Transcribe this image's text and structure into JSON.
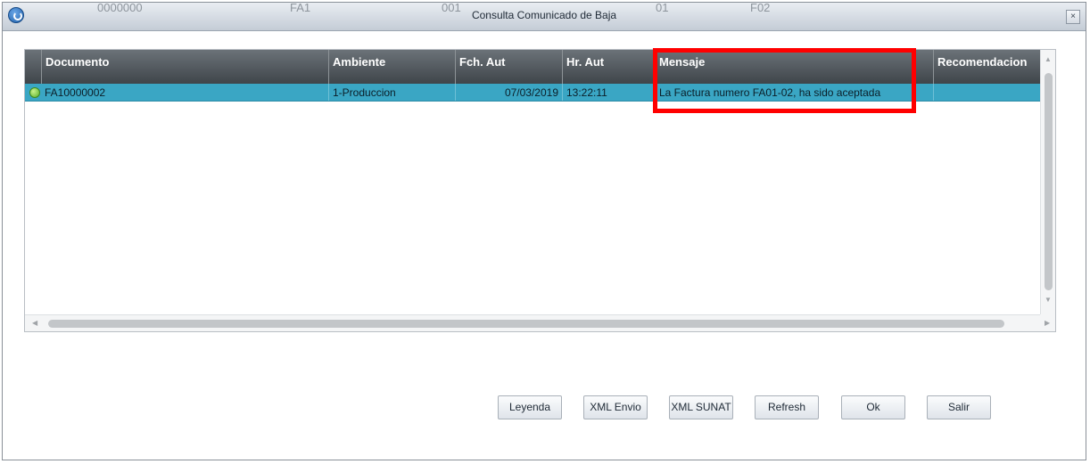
{
  "window": {
    "title": "Consulta Comunicado de Baja",
    "close_label": "×",
    "ghost_texts": [
      "0000000",
      "FA1",
      "001",
      "01",
      "F02"
    ]
  },
  "grid": {
    "columns": [
      "Documento",
      "Ambiente",
      "Fch. Aut",
      "Hr. Aut",
      "Mensaje",
      "Recomendacion"
    ],
    "rows": [
      {
        "status": "aceptado",
        "documento": "FA10000002",
        "ambiente": "1-Produccion",
        "fch_aut": "07/03/2019",
        "hr_aut": "13:22:11",
        "mensaje": "La Factura numero FA01-02, ha sido aceptada",
        "recomendacion": ""
      }
    ]
  },
  "buttons": {
    "leyenda": "Leyenda",
    "xml_envio": "XML Envio",
    "xml_sunat": "XML SUNAT",
    "refresh": "Refresh",
    "ok": "Ok",
    "salir": "Salir"
  },
  "colors": {
    "selected_row": "#3aa6c4",
    "header": "#4b5156",
    "highlight_box": "#ff0000",
    "status_ok": "#58b02a"
  }
}
